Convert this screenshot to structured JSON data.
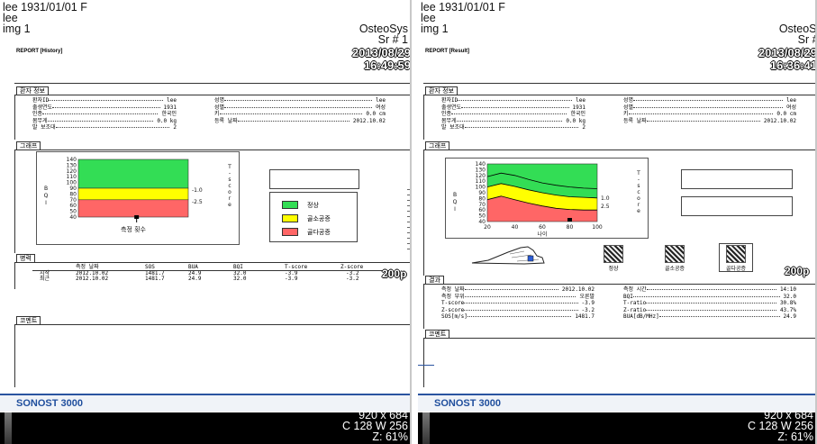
{
  "left": {
    "patient_line": "lee 1931/01/01 F",
    "patient_name": "lee",
    "image_label": "img 1",
    "app_name": "OsteoSys",
    "series": "Sr # 1",
    "report_title": "REPORT [History]",
    "report_date": "2013/08/29",
    "report_time": "16:49:59",
    "patient_section": "환자 정보",
    "fields_left": [
      {
        "label": "환자ID",
        "value": "lee"
      },
      {
        "label": "출생연도",
        "value": "1931"
      },
      {
        "label": "인종",
        "value": "한국인"
      },
      {
        "label": "몸무게",
        "value": "0.0 kg"
      },
      {
        "label": "발 보조대",
        "value": "2"
      }
    ],
    "fields_right": [
      {
        "label": "성명",
        "value": "lee"
      },
      {
        "label": "성별",
        "value": "여성"
      },
      {
        "label": "키",
        "value": "0.0 cm"
      },
      {
        "label": "등록 날짜",
        "value": "2012.10.02"
      }
    ],
    "graph_section": "그래프",
    "graph_xlabel": "측정 횟수",
    "legend": [
      {
        "label": "정상",
        "color": "#33dd55"
      },
      {
        "label": "골소공증",
        "color": "#ffff00"
      },
      {
        "label": "골다공증",
        "color": "#ff6666"
      }
    ],
    "history_section": "병력",
    "history_headers": [
      "측정 날짜",
      "SOS",
      "BUA",
      "BQI",
      "T-score",
      "Z-score"
    ],
    "history_rows": [
      {
        "label": "시작",
        "date": "2012.10.02",
        "sos": "1481.7",
        "bua": "24.9",
        "bqi": "32.0",
        "t": "-3.9",
        "z": "-3.2"
      },
      {
        "label": "최근",
        "date": "2012.10.02",
        "sos": "1481.7",
        "bua": "24.9",
        "bqi": "32.0",
        "t": "-3.9",
        "z": "-3.2"
      }
    ],
    "tag": "200p",
    "comment_section": "코멘트",
    "footer_brand": "SONOST 3000",
    "size_info": "920 x 684",
    "window_info": "C 128 W 256",
    "zoom_info": "Z: 61%"
  },
  "right": {
    "patient_line": "lee 1931/01/01 F",
    "patient_name": "lee",
    "image_label": "img 1",
    "app_name": "OsteoSys",
    "series": "Sr # 1",
    "report_title": "REPORT [Result]",
    "report_date": "2013/08/29",
    "report_time": "16:36:41",
    "patient_section": "환자 정보",
    "fields_left": [
      {
        "label": "환자ID",
        "value": "lee"
      },
      {
        "label": "출생연도",
        "value": "1931"
      },
      {
        "label": "인종",
        "value": "한국인"
      },
      {
        "label": "몸무게",
        "value": "0.0 kg"
      },
      {
        "label": "발 보조대",
        "value": "2"
      }
    ],
    "fields_right": [
      {
        "label": "성명",
        "value": "lee"
      },
      {
        "label": "성별",
        "value": "여성"
      },
      {
        "label": "키",
        "value": "0.0 cm"
      },
      {
        "label": "등록 날짜",
        "value": "2012.10.02"
      }
    ],
    "graph_section": "그래프",
    "graph_xlabel": "나이",
    "thumb_labels": [
      "정상",
      "골소공증",
      "골다공증"
    ],
    "tag": "200p",
    "result_section": "결과",
    "results_left": [
      {
        "label": "측정 날짜",
        "value": "2012.10.02"
      },
      {
        "label": "측정 부위",
        "value": "오른발"
      },
      {
        "label": "T-score",
        "value": "-3.9"
      },
      {
        "label": "Z-score",
        "value": "-3.2"
      },
      {
        "label": "SOS[m/s]",
        "value": "1481.7"
      }
    ],
    "results_right": [
      {
        "label": "측정 시간",
        "value": "14:10"
      },
      {
        "label": "BQI",
        "value": "32.0"
      },
      {
        "label": "T-ratio",
        "value": "30.8%"
      },
      {
        "label": "Z-ratio",
        "value": "43.7%"
      },
      {
        "label": "BUA[dB/MHz]",
        "value": "24.9"
      }
    ],
    "comment_section": "코멘트",
    "footer_brand": "SONOST 3000",
    "size_info": "920 x 684",
    "window_info": "C 128 W 256",
    "zoom_info": "Z: 61%"
  },
  "chart_data": [
    {
      "type": "bar",
      "ylabel": "BQI",
      "y2label": "T-score",
      "xlabel": "측정 횟수",
      "y_ticks": [
        40,
        50,
        60,
        70,
        80,
        90,
        100,
        110,
        120,
        130,
        140
      ],
      "ylim": [
        40,
        140
      ],
      "y2_ticks": [
        -1.0,
        -2.5
      ],
      "zones": [
        {
          "name": "정상",
          "from": 90,
          "to": 140,
          "color": "#33dd55"
        },
        {
          "name": "골소공증",
          "from": 70,
          "to": 90,
          "color": "#ffff00"
        },
        {
          "name": "골다공증",
          "from": 40,
          "to": 70,
          "color": "#ff6666"
        }
      ],
      "points": [
        {
          "x": 1,
          "y": 32.0
        }
      ]
    },
    {
      "type": "line",
      "ylabel": "BQI",
      "y2label": "T-score",
      "xlabel": "나이",
      "x_ticks": [
        20,
        40,
        60,
        80,
        100
      ],
      "xlim": [
        20,
        100
      ],
      "y_ticks": [
        40,
        50,
        60,
        70,
        80,
        90,
        100,
        110,
        120,
        130,
        140
      ],
      "ylim": [
        40,
        140
      ],
      "y2_ticks": [
        1.0,
        2.5
      ],
      "zones": [
        {
          "name": "정상",
          "color": "#33dd55"
        },
        {
          "name": "골소공증",
          "color": "#ffff00"
        },
        {
          "name": "골다공증",
          "color": "#ff6666"
        }
      ],
      "upper_boundary": [
        [
          20,
          100
        ],
        [
          30,
          106
        ],
        [
          40,
          101
        ],
        [
          50,
          95
        ],
        [
          60,
          90
        ],
        [
          70,
          86
        ],
        [
          80,
          83
        ],
        [
          90,
          82
        ],
        [
          100,
          81
        ]
      ],
      "lower_boundary": [
        [
          20,
          78
        ],
        [
          30,
          84
        ],
        [
          40,
          78
        ],
        [
          50,
          72
        ],
        [
          60,
          67
        ],
        [
          70,
          63
        ],
        [
          80,
          61
        ],
        [
          90,
          60
        ],
        [
          100,
          60
        ]
      ],
      "mid_curve": [
        [
          20,
          118
        ],
        [
          30,
          124
        ],
        [
          40,
          120
        ],
        [
          50,
          113
        ],
        [
          60,
          107
        ],
        [
          70,
          103
        ],
        [
          80,
          100
        ],
        [
          90,
          98
        ],
        [
          100,
          97
        ]
      ],
      "points": [
        {
          "x": 80,
          "y": 32.0
        }
      ]
    }
  ]
}
